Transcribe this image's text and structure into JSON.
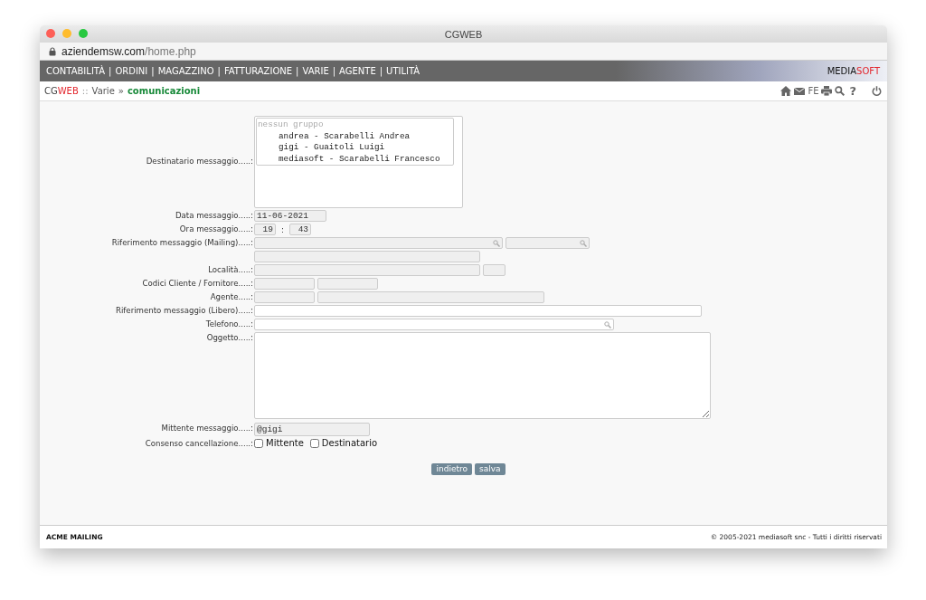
{
  "window": {
    "title": "CGWEB",
    "address_host": "aziendemsw.com",
    "address_path": "/home.php"
  },
  "menu": {
    "separator": "|",
    "items": [
      {
        "label": "CONTABILITÀ"
      },
      {
        "label": "ORDINI"
      },
      {
        "label": "MAGAZZINO"
      },
      {
        "label": "FATTURAZIONE"
      },
      {
        "label": "VARIE"
      },
      {
        "label": "AGENTE"
      },
      {
        "label": "UTILITÀ"
      }
    ]
  },
  "brand": {
    "first": "MEDIA",
    "second": "SOFT"
  },
  "breadcrumb": {
    "app_first": "CG",
    "app_second": "WEB",
    "separator": "::",
    "section": "Varie",
    "arrow": "»",
    "current": "comunicazioni"
  },
  "toolbar": {
    "fe_label": "FE",
    "help_label": "?"
  },
  "form": [
    {
      "kind": "recipients",
      "label": "Destinatario messaggio.....:",
      "options": [
        {
          "text": "nessun gruppo",
          "disabled": true,
          "selected": false
        },
        {
          "text": "andrea - Scarabelli Andrea",
          "disabled": false,
          "selected": false
        },
        {
          "text": "gigi - Guaitoli Luigi",
          "disabled": false,
          "selected": false
        },
        {
          "text": "mediasoft - Scarabelli Francesco",
          "disabled": false,
          "selected": false
        }
      ]
    },
    {
      "kind": "date",
      "label": "Data messaggio.....:",
      "fields": [
        {
          "value": "11-06-2021",
          "disabled": true,
          "lookup": false
        }
      ]
    },
    {
      "kind": "time",
      "label": "Ora messaggio.....:",
      "separator": ":",
      "fields": [
        {
          "value": "19",
          "disabled": true,
          "lookup": false
        },
        {
          "value": "43",
          "disabled": true,
          "lookup": false
        }
      ]
    },
    {
      "kind": "mailing",
      "label": "Riferimento messaggio (Mailing).....:",
      "fields": [
        {
          "disabled": true,
          "lookup": true
        },
        {
          "disabled": true,
          "lookup": true
        }
      ]
    },
    {
      "kind": "address",
      "fields": [
        {
          "disabled": true,
          "lookup": false
        }
      ]
    },
    {
      "kind": "place",
      "label": "Località.....:",
      "fields": [
        {
          "disabled": true,
          "lookup": false
        },
        {
          "disabled": true,
          "lookup": false
        }
      ]
    },
    {
      "kind": "codes",
      "label": "Codici Cliente / Fornitore.....:",
      "fields": [
        {
          "disabled": true,
          "lookup": false
        },
        {
          "disabled": true,
          "lookup": false
        }
      ]
    },
    {
      "kind": "agent",
      "label": "Agente.....:",
      "fields": [
        {
          "disabled": true,
          "lookup": false
        },
        {
          "disabled": true,
          "lookup": false
        }
      ]
    },
    {
      "kind": "free",
      "label": "Riferimento messaggio (Libero).....:",
      "fields": [
        {
          "disabled": false,
          "lookup": false
        }
      ]
    },
    {
      "kind": "phone",
      "label": "Telefono.....:",
      "fields": [
        {
          "disabled": false,
          "lookup": true
        }
      ]
    },
    {
      "kind": "subject",
      "label": "Oggetto.....:"
    },
    {
      "kind": "sender",
      "label": "Mittente messaggio.....:",
      "fields": [
        {
          "value": "@gigi",
          "disabled": true,
          "lookup": false
        }
      ]
    },
    {
      "kind": "consent",
      "label": "Consenso cancellazione.....:",
      "checks": [
        {
          "label": "Mittente",
          "checked": false
        },
        {
          "label": "Destinatario",
          "checked": false
        }
      ]
    }
  ],
  "buttons": [
    {
      "label": "indietro"
    },
    {
      "label": "salva"
    }
  ],
  "footer": {
    "left": "ACME MAILING",
    "right": "© 2005-2021 mediasoft snc - Tutti i diritti riservati"
  }
}
